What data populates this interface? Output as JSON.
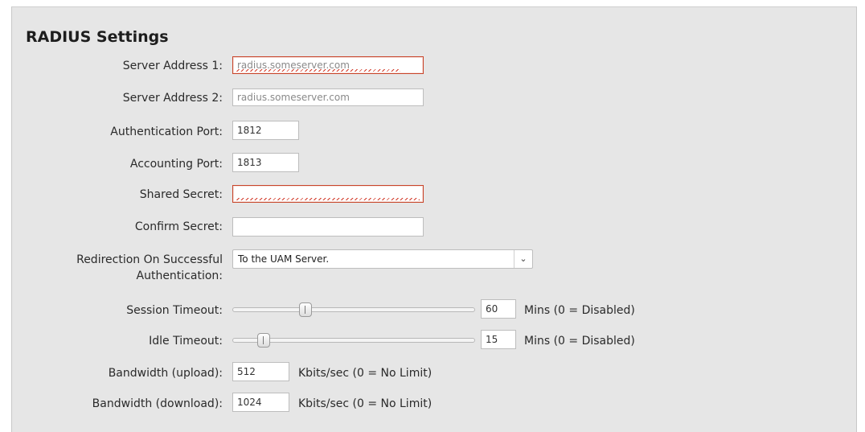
{
  "section": {
    "title": "RADIUS Settings"
  },
  "fields": {
    "server_address_1": {
      "label": "Server Address 1:",
      "placeholder": "radius.someserver.com"
    },
    "server_address_2": {
      "label": "Server Address 2:",
      "placeholder": "radius.someserver.com"
    },
    "auth_port": {
      "label": "Authentication Port:",
      "value": "1812"
    },
    "accounting_port": {
      "label": "Accounting Port:",
      "value": "1813"
    },
    "shared_secret": {
      "label": "Shared Secret:",
      "value": ""
    },
    "confirm_secret": {
      "label": "Confirm Secret:",
      "value": ""
    },
    "redirection": {
      "label_line1": "Redirection On Successful",
      "label_line2": "Authentication:",
      "selected": "To the UAM Server."
    },
    "session_timeout": {
      "label": "Session Timeout:",
      "value": "60",
      "unit": "Mins (0 = Disabled)",
      "slider_fraction": 0.29
    },
    "idle_timeout": {
      "label": "Idle Timeout:",
      "value": "15",
      "unit": "Mins (0 = Disabled)",
      "slider_fraction": 0.11
    },
    "bandwidth_upload": {
      "label": "Bandwidth (upload):",
      "value": "512",
      "unit": "Kbits/sec (0 = No Limit)"
    },
    "bandwidth_download": {
      "label": "Bandwidth (download):",
      "value": "1024",
      "unit": "Kbits/sec (0 = No Limit)"
    }
  },
  "colors": {
    "panel_bg": "#e6e6e6",
    "error_border": "#c8452a"
  }
}
